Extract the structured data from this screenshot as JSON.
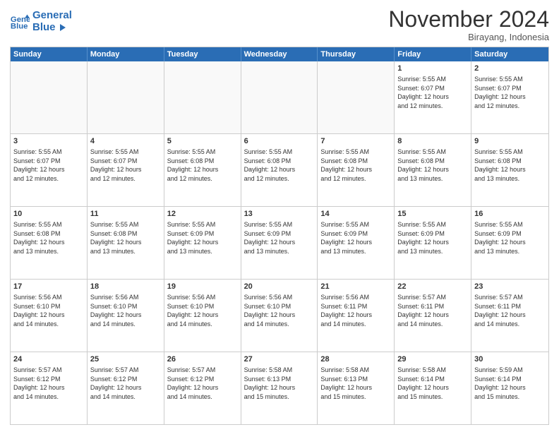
{
  "header": {
    "logo_line1": "General",
    "logo_line2": "Blue",
    "month": "November 2024",
    "location": "Birayang, Indonesia"
  },
  "weekdays": [
    "Sunday",
    "Monday",
    "Tuesday",
    "Wednesday",
    "Thursday",
    "Friday",
    "Saturday"
  ],
  "weeks": [
    [
      {
        "day": "",
        "info": "",
        "empty": true
      },
      {
        "day": "",
        "info": "",
        "empty": true
      },
      {
        "day": "",
        "info": "",
        "empty": true
      },
      {
        "day": "",
        "info": "",
        "empty": true
      },
      {
        "day": "",
        "info": "",
        "empty": true
      },
      {
        "day": "1",
        "info": "Sunrise: 5:55 AM\nSunset: 6:07 PM\nDaylight: 12 hours\nand 12 minutes.",
        "empty": false
      },
      {
        "day": "2",
        "info": "Sunrise: 5:55 AM\nSunset: 6:07 PM\nDaylight: 12 hours\nand 12 minutes.",
        "empty": false
      }
    ],
    [
      {
        "day": "3",
        "info": "Sunrise: 5:55 AM\nSunset: 6:07 PM\nDaylight: 12 hours\nand 12 minutes.",
        "empty": false
      },
      {
        "day": "4",
        "info": "Sunrise: 5:55 AM\nSunset: 6:07 PM\nDaylight: 12 hours\nand 12 minutes.",
        "empty": false
      },
      {
        "day": "5",
        "info": "Sunrise: 5:55 AM\nSunset: 6:08 PM\nDaylight: 12 hours\nand 12 minutes.",
        "empty": false
      },
      {
        "day": "6",
        "info": "Sunrise: 5:55 AM\nSunset: 6:08 PM\nDaylight: 12 hours\nand 12 minutes.",
        "empty": false
      },
      {
        "day": "7",
        "info": "Sunrise: 5:55 AM\nSunset: 6:08 PM\nDaylight: 12 hours\nand 12 minutes.",
        "empty": false
      },
      {
        "day": "8",
        "info": "Sunrise: 5:55 AM\nSunset: 6:08 PM\nDaylight: 12 hours\nand 13 minutes.",
        "empty": false
      },
      {
        "day": "9",
        "info": "Sunrise: 5:55 AM\nSunset: 6:08 PM\nDaylight: 12 hours\nand 13 minutes.",
        "empty": false
      }
    ],
    [
      {
        "day": "10",
        "info": "Sunrise: 5:55 AM\nSunset: 6:08 PM\nDaylight: 12 hours\nand 13 minutes.",
        "empty": false
      },
      {
        "day": "11",
        "info": "Sunrise: 5:55 AM\nSunset: 6:08 PM\nDaylight: 12 hours\nand 13 minutes.",
        "empty": false
      },
      {
        "day": "12",
        "info": "Sunrise: 5:55 AM\nSunset: 6:09 PM\nDaylight: 12 hours\nand 13 minutes.",
        "empty": false
      },
      {
        "day": "13",
        "info": "Sunrise: 5:55 AM\nSunset: 6:09 PM\nDaylight: 12 hours\nand 13 minutes.",
        "empty": false
      },
      {
        "day": "14",
        "info": "Sunrise: 5:55 AM\nSunset: 6:09 PM\nDaylight: 12 hours\nand 13 minutes.",
        "empty": false
      },
      {
        "day": "15",
        "info": "Sunrise: 5:55 AM\nSunset: 6:09 PM\nDaylight: 12 hours\nand 13 minutes.",
        "empty": false
      },
      {
        "day": "16",
        "info": "Sunrise: 5:55 AM\nSunset: 6:09 PM\nDaylight: 12 hours\nand 13 minutes.",
        "empty": false
      }
    ],
    [
      {
        "day": "17",
        "info": "Sunrise: 5:56 AM\nSunset: 6:10 PM\nDaylight: 12 hours\nand 14 minutes.",
        "empty": false
      },
      {
        "day": "18",
        "info": "Sunrise: 5:56 AM\nSunset: 6:10 PM\nDaylight: 12 hours\nand 14 minutes.",
        "empty": false
      },
      {
        "day": "19",
        "info": "Sunrise: 5:56 AM\nSunset: 6:10 PM\nDaylight: 12 hours\nand 14 minutes.",
        "empty": false
      },
      {
        "day": "20",
        "info": "Sunrise: 5:56 AM\nSunset: 6:10 PM\nDaylight: 12 hours\nand 14 minutes.",
        "empty": false
      },
      {
        "day": "21",
        "info": "Sunrise: 5:56 AM\nSunset: 6:11 PM\nDaylight: 12 hours\nand 14 minutes.",
        "empty": false
      },
      {
        "day": "22",
        "info": "Sunrise: 5:57 AM\nSunset: 6:11 PM\nDaylight: 12 hours\nand 14 minutes.",
        "empty": false
      },
      {
        "day": "23",
        "info": "Sunrise: 5:57 AM\nSunset: 6:11 PM\nDaylight: 12 hours\nand 14 minutes.",
        "empty": false
      }
    ],
    [
      {
        "day": "24",
        "info": "Sunrise: 5:57 AM\nSunset: 6:12 PM\nDaylight: 12 hours\nand 14 minutes.",
        "empty": false
      },
      {
        "day": "25",
        "info": "Sunrise: 5:57 AM\nSunset: 6:12 PM\nDaylight: 12 hours\nand 14 minutes.",
        "empty": false
      },
      {
        "day": "26",
        "info": "Sunrise: 5:57 AM\nSunset: 6:12 PM\nDaylight: 12 hours\nand 14 minutes.",
        "empty": false
      },
      {
        "day": "27",
        "info": "Sunrise: 5:58 AM\nSunset: 6:13 PM\nDaylight: 12 hours\nand 15 minutes.",
        "empty": false
      },
      {
        "day": "28",
        "info": "Sunrise: 5:58 AM\nSunset: 6:13 PM\nDaylight: 12 hours\nand 15 minutes.",
        "empty": false
      },
      {
        "day": "29",
        "info": "Sunrise: 5:58 AM\nSunset: 6:14 PM\nDaylight: 12 hours\nand 15 minutes.",
        "empty": false
      },
      {
        "day": "30",
        "info": "Sunrise: 5:59 AM\nSunset: 6:14 PM\nDaylight: 12 hours\nand 15 minutes.",
        "empty": false
      }
    ]
  ]
}
